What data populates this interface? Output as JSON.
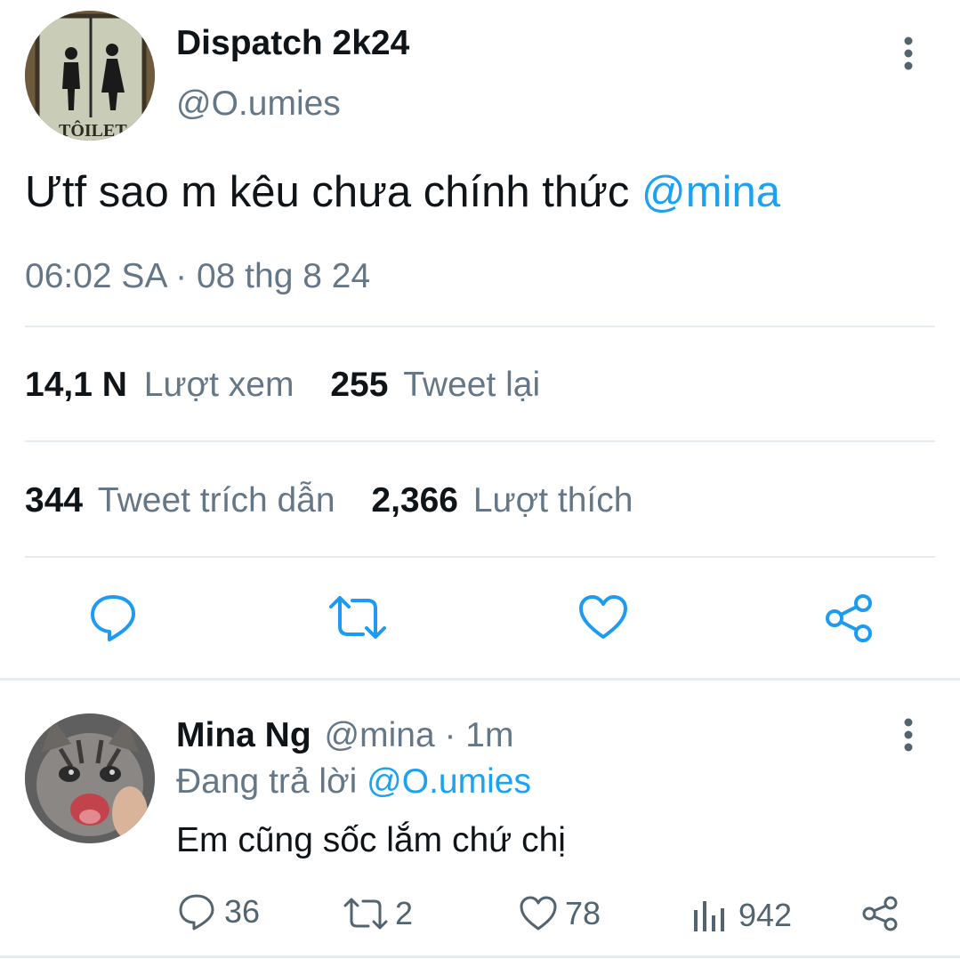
{
  "tweet": {
    "author_name": "Dispatch 2k24",
    "handle": "@O.umies",
    "avatar_sign_text": "TÔILET",
    "text": "Ưtf sao m kêu chưa chính thức ",
    "mention": "@mina",
    "timestamp": "06:02 SA · 08 thg 8 24",
    "stats": {
      "views_count": "14,1 N",
      "views_label": "Lượt xem",
      "retweets_count": "255",
      "retweets_label": "Tweet lại",
      "quotes_count": "344",
      "quotes_label": "Tweet trích dẫn",
      "likes_count": "2,366",
      "likes_label": "Lượt thích"
    }
  },
  "reply": {
    "author_name": "Mina Ng",
    "handle_time": "@mina · 1m",
    "replying_prefix": "Đang trả lời ",
    "replying_to": "@O.umies",
    "text": "Em cũng sốc lắm chứ chị",
    "counts": {
      "replies": "36",
      "retweets": "2",
      "likes": "78",
      "views": "942"
    }
  },
  "colors": {
    "link": "#1da1f2",
    "muted": "#657786",
    "divider": "#e6ecf0",
    "icon": "#1d9bf0"
  }
}
